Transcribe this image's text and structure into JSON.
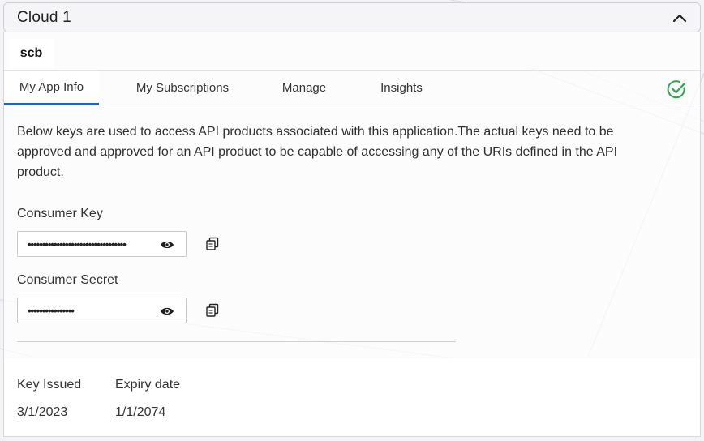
{
  "accordion": {
    "title": "Cloud 1"
  },
  "application": {
    "name": "scb"
  },
  "tabs": [
    {
      "label": "My App Info"
    },
    {
      "label": "My Subscriptions"
    },
    {
      "label": "Manage"
    },
    {
      "label": "Insights"
    }
  ],
  "active_tab": "My App Info",
  "status_icon": "check-circle-icon",
  "colors": {
    "accent": "#1a63c7",
    "status": "#2aa84a"
  },
  "description": "Below keys are used to access API products associated with this application.The actual keys need to be approved and approved for an API product to be capable of accessing any of the URIs defined in the API product.",
  "consumer_key": {
    "label": "Consumer Key",
    "value": "••••••••••••••••••••••••••••••••••"
  },
  "consumer_secret": {
    "label": "Consumer Secret",
    "value": "••••••••••••••••"
  },
  "key_info": {
    "issued_label": "Key Issued",
    "issued_value": "3/1/2023",
    "expiry_label": "Expiry date",
    "expiry_value": "1/1/2074"
  }
}
